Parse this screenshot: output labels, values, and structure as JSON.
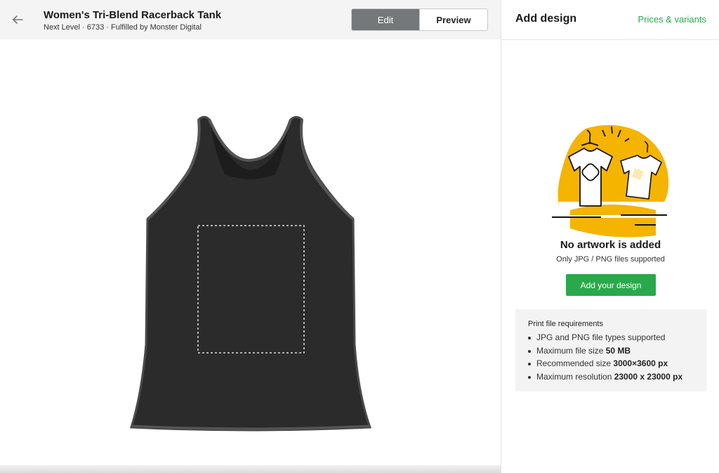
{
  "header": {
    "title": "Women's Tri-Blend Racerback Tank",
    "meta": "Next Level · 6733 · Fulfilled by Monster Digital",
    "mode_edit": "Edit",
    "mode_preview": "Preview"
  },
  "canvas": {
    "product_color": "#2a2a2a",
    "print_area_border": "dashed white"
  },
  "panel": {
    "title": "Add design",
    "prices_link": "Prices & variants",
    "empty_title": "No artwork is added",
    "empty_subtitle": "Only JPG / PNG files supported",
    "add_button": "Add your design",
    "requirements": {
      "title": "Print file requirements",
      "items": [
        {
          "text": "JPG and PNG file types supported",
          "bold": ""
        },
        {
          "text": "Maximum file size ",
          "bold": "50 MB"
        },
        {
          "text": "Recommended size ",
          "bold": "3000×3600 px"
        },
        {
          "text": "Maximum resolution ",
          "bold": "23000 x 23000 px"
        }
      ]
    }
  },
  "colors": {
    "accent_green": "#29a94b",
    "edit_active_bg": "#75787a",
    "illustration_yellow": "#f5b400"
  },
  "icons": {
    "back": "arrow-left-icon",
    "keyboard": "keyboard-icon"
  }
}
